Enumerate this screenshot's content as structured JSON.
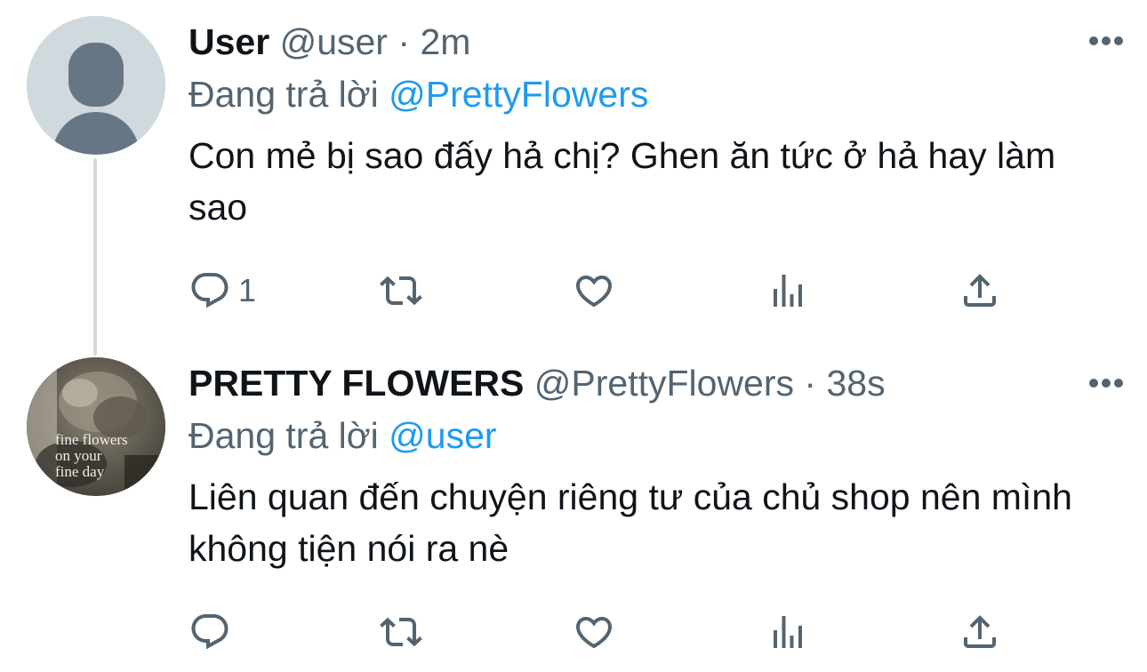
{
  "tweets": [
    {
      "display_name": "User",
      "handle": "@user",
      "separator": "·",
      "time": "2m",
      "reply_prefix": "Đang trả lời",
      "reply_to": "@PrettyFlowers",
      "text": "Con mẻ bị sao đấy hả chị? Ghen ăn tức ở hả hay làm sao",
      "reply_count": "1",
      "avatar_icon": "default-profile-icon"
    },
    {
      "display_name": "PRETTY FLOWERS",
      "handle": "@PrettyFlowers",
      "separator": "·",
      "time": "38s",
      "reply_prefix": "Đang trả lời",
      "reply_to": "@user",
      "text": "Liên quan đến chuyện riêng tư của chủ shop nên mình không tiện nói ra nè",
      "reply_count": "",
      "avatar_text": [
        "fine flowers",
        "on your",
        "fine day"
      ]
    }
  ],
  "action_icons": [
    "reply-icon",
    "retweet-icon",
    "like-icon",
    "views-icon",
    "share-icon"
  ],
  "colors": {
    "accent": "#1d9bf0",
    "secondary_text": "#536471",
    "primary_text": "#0f1419",
    "thread_line": "#cfd9de"
  }
}
